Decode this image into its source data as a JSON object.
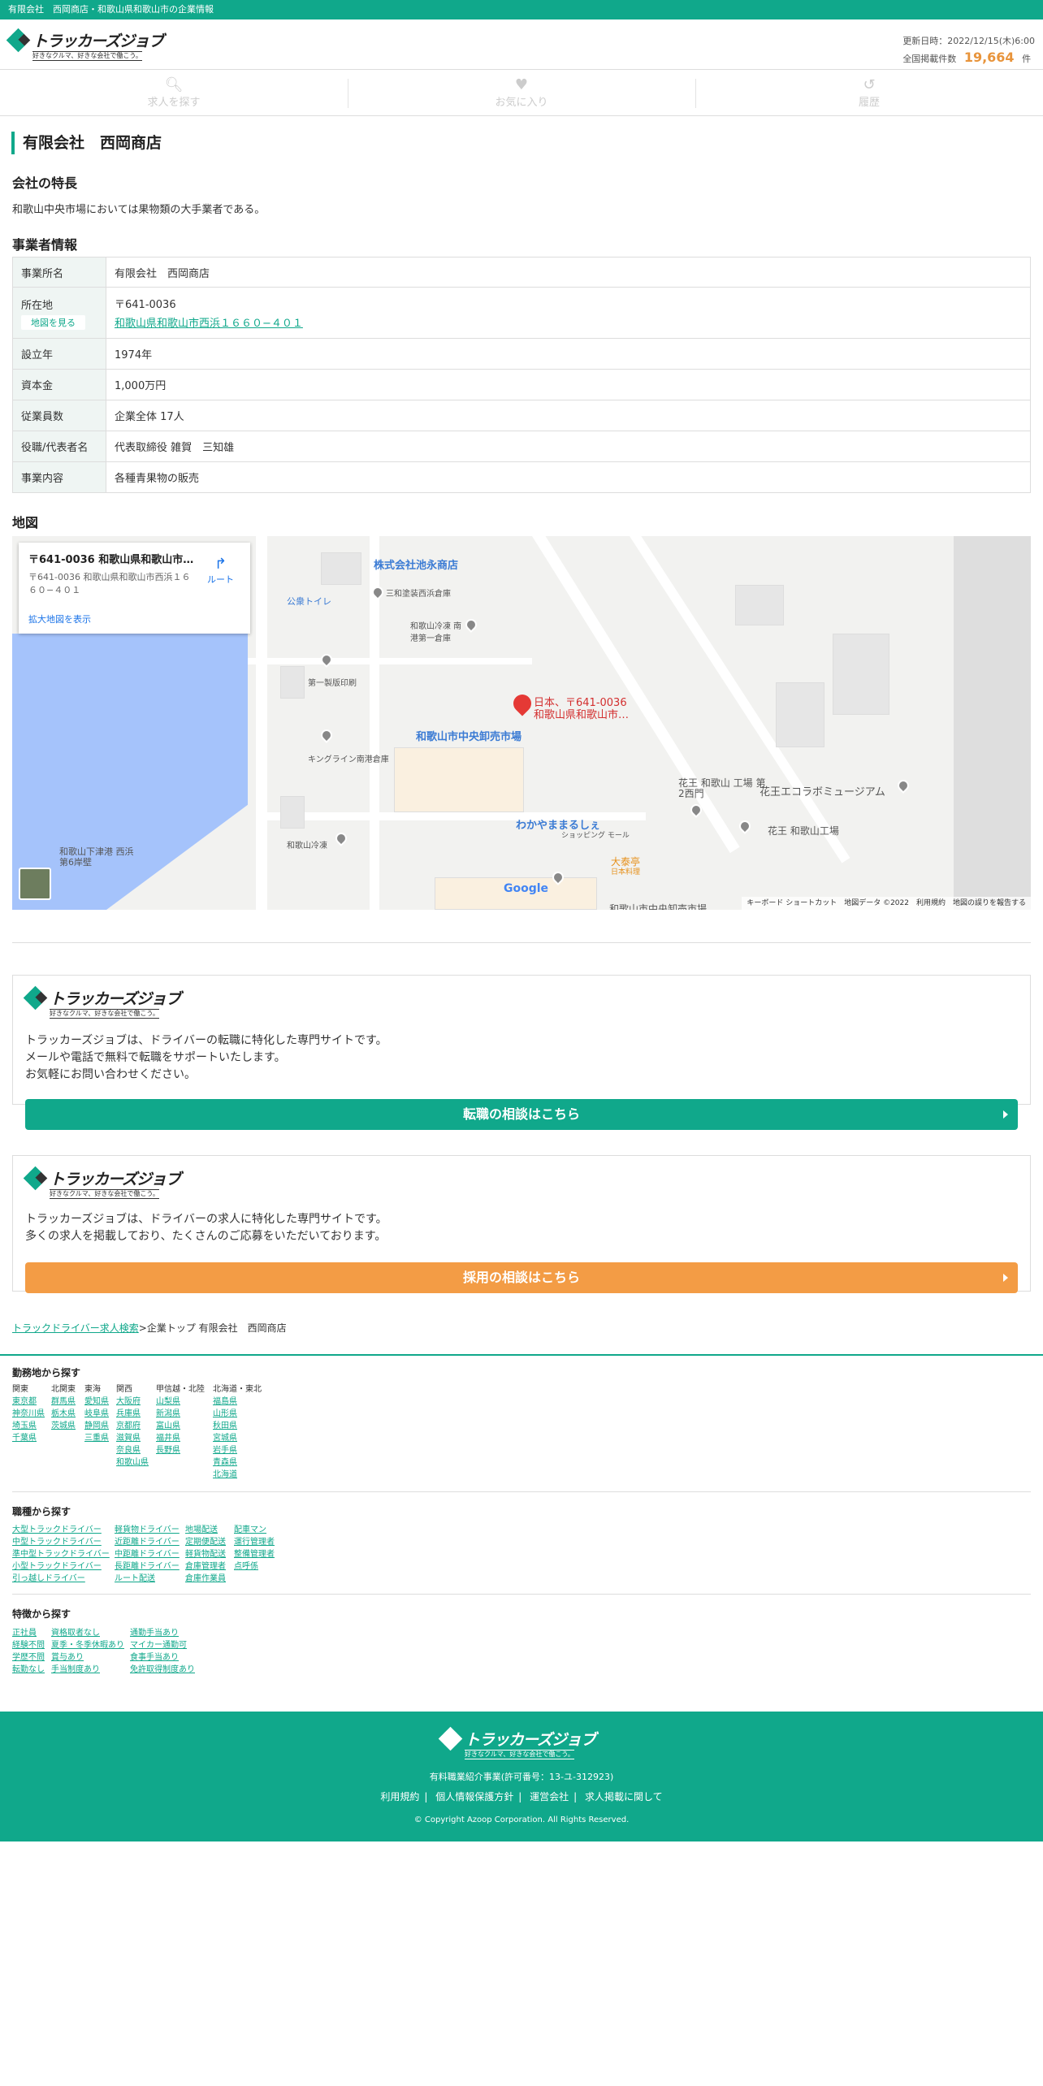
{
  "topbar": {
    "text": "有限会社　西岡商店・和歌山県和歌山市の企業情報"
  },
  "logo": {
    "brand": "トラッカーズジョブ",
    "tagline": "好きなクルマ、好きな会社で働こう。"
  },
  "update": {
    "date_label": "更新日時：2022/12/15(木)6:00",
    "total_label": "全国掲載件数",
    "total_count": "19,664",
    "unit": "件"
  },
  "nav": {
    "search": "求人を探す",
    "favorite": "お気に入り",
    "history": "履歴"
  },
  "company": {
    "name": "有限会社　西岡商店"
  },
  "features": {
    "heading": "会社の特長",
    "text": "和歌山中央市場においては果物類の大手業者である。"
  },
  "info": {
    "heading": "事業者情報",
    "rows": [
      {
        "label": "事業所名",
        "value": "有限会社　西岡商店"
      },
      {
        "label": "所在地",
        "zip": "〒641-0036",
        "address": "和歌山県和歌山市西浜１６６０−４０１",
        "map_button": "地図を見る"
      },
      {
        "label": "設立年",
        "value": "1974年"
      },
      {
        "label": "資本金",
        "value": "1,000万円"
      },
      {
        "label": "従業員数",
        "value": "企業全体 17人"
      },
      {
        "label": "役職/代表者名",
        "value": "代表取締役 雑賀　三知雄"
      },
      {
        "label": "事業内容",
        "value": "各種青果物の販売"
      }
    ]
  },
  "map": {
    "heading": "地図",
    "card_title": "〒641-0036 和歌山県和歌山市…",
    "card_sub": "〒641-0036 和歌山県和歌山市西浜１６６０−４０１",
    "route": "ルート",
    "enlarge": "拡大地図を表示",
    "pin_label_1": "日本、〒641-0036",
    "pin_label_2": "和歌山県和歌山市…",
    "labels": [
      "株式会社池永商店",
      "公衆トイレ",
      "三和塗装西浜倉庫",
      "和歌山冷凍 南港第一倉庫",
      "第一製版印刷",
      "和歌山市中央卸売市場",
      "キングライン南港倉庫",
      "花王 和歌山 工場 第2西門",
      "花王エコラボミュージアム",
      "わかやままるしぇ",
      "ショッピング モール",
      "花王 和歌山工場",
      "和歌山冷凍",
      "大泰亭",
      "日本料理",
      "和歌山下津港 西浜第6岸壁",
      "和歌山市中央卸売市場"
    ],
    "footer": "キーボード ショートカット　地図データ ©2022　利用規約　地図の誤りを報告する",
    "google": "Google"
  },
  "promo1": {
    "line1": "トラッカーズジョブは、ドライバーの転職に特化した専門サイトです。",
    "line2": "メールや電話で無料で転職をサポートいたします。",
    "line3": "お気軽にお問い合わせください。",
    "button": "転職の相談はこちら",
    "color": "#10a88b"
  },
  "promo2": {
    "line1": "トラッカーズジョブは、ドライバーの求人に特化した専門サイトです。",
    "line2": "多くの求人を掲載しており、たくさんのご応募をいただいております。",
    "button": "採用の相談はこちら",
    "color": "#f39c45"
  },
  "breadcrumb": {
    "link": "トラックドライバー求人検索",
    "rest": ">企業トップ 有限会社　西岡商店"
  },
  "area": {
    "heading": "勤務地から探す",
    "cols": [
      {
        "head": "関東",
        "items": [
          "東京都",
          "神奈川県",
          "埼玉県",
          "千葉県"
        ]
      },
      {
        "head": "北関東",
        "items": [
          "群馬県",
          "栃木県",
          "茨城県"
        ]
      },
      {
        "head": "東海",
        "items": [
          "愛知県",
          "岐阜県",
          "静岡県",
          "三重県"
        ]
      },
      {
        "head": "関西",
        "items": [
          "大阪府",
          "兵庫県",
          "京都府",
          "滋賀県",
          "奈良県",
          "和歌山県"
        ]
      },
      {
        "head": "甲信越・北陸",
        "items": [
          "山梨県",
          "新潟県",
          "富山県",
          "福井県",
          "長野県"
        ]
      },
      {
        "head": "北海道・東北",
        "items": [
          "福島県",
          "山形県",
          "秋田県",
          "宮城県",
          "岩手県",
          "青森県",
          "北海道"
        ]
      }
    ]
  },
  "jobtype": {
    "heading": "職種から探す",
    "cols": [
      {
        "items": [
          "大型トラックドライバー",
          "中型トラックドライバー",
          "準中型トラックドライバー",
          "小型トラックドライバー",
          "引っ越しドライバー"
        ]
      },
      {
        "items": [
          "軽貨物ドライバー",
          "近距離ドライバー",
          "中距離ドライバー",
          "長距離ドライバー",
          "ルート配送"
        ]
      },
      {
        "items": [
          "地場配送",
          "定期便配送",
          "軽貨物配送",
          "倉庫管理者",
          "倉庫作業員"
        ]
      },
      {
        "items": [
          "配車マン",
          "運行管理者",
          "整備管理者",
          "点呼係"
        ]
      }
    ]
  },
  "feature_search": {
    "heading": "特徴から探す",
    "cols": [
      {
        "items": [
          "正社員",
          "経験不問",
          "学歴不問",
          "転勤なし"
        ]
      },
      {
        "items": [
          "資格取者なし",
          "夏季・冬季休暇あり",
          "賞与あり",
          "手当制度あり"
        ]
      },
      {
        "items": [
          "通勤手当あり",
          "マイカー通勤可",
          "食事手当あり",
          "免許取得制度あり"
        ]
      }
    ]
  },
  "footer": {
    "license": "有料職業紹介事業(許可番号：13-ユ-312923)",
    "links": [
      "利用規約",
      "個人情報保護方針",
      "運営会社",
      "求人掲載に関して"
    ],
    "copyright": "© Copyright Azoop Corporation. All Rights Reserved."
  }
}
